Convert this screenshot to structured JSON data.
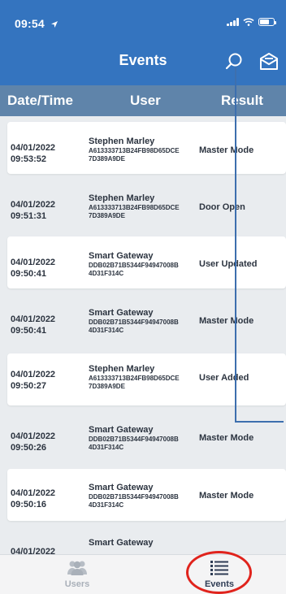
{
  "status_bar": {
    "time": "09:54"
  },
  "header": {
    "title": "Events",
    "search_icon": "search-icon",
    "mail_icon": "mail-icon"
  },
  "columns": {
    "datetime": "Date/Time",
    "user": "User",
    "result": "Result"
  },
  "events": [
    {
      "date": "04/01/2022",
      "time": "09:53:52",
      "user_name": "Stephen Marley",
      "user_id_1": "A613333713B24FB98D65DCE",
      "user_id_2": "7D389A9DE",
      "result": "Master Mode"
    },
    {
      "date": "04/01/2022",
      "time": "09:51:31",
      "user_name": "Stephen Marley",
      "user_id_1": "A613333713B24FB98D65DCE",
      "user_id_2": "7D389A9DE",
      "result": "Door Open"
    },
    {
      "date": "04/01/2022",
      "time": "09:50:41",
      "user_name": "Smart Gateway",
      "user_id_1": "DDB02B71B5344F94947008B",
      "user_id_2": "4D31F314C",
      "result": "User Updated"
    },
    {
      "date": "04/01/2022",
      "time": "09:50:41",
      "user_name": "Smart Gateway",
      "user_id_1": "DDB02B71B5344F94947008B",
      "user_id_2": "4D31F314C",
      "result": "Master Mode"
    },
    {
      "date": "04/01/2022",
      "time": "09:50:27",
      "user_name": "Stephen Marley",
      "user_id_1": "A613333713B24FB98D65DCE",
      "user_id_2": "7D389A9DE",
      "result": "User Added"
    },
    {
      "date": "04/01/2022",
      "time": "09:50:26",
      "user_name": "Smart Gateway",
      "user_id_1": "DDB02B71B5344F94947008B",
      "user_id_2": "4D31F314C",
      "result": "Master Mode"
    },
    {
      "date": "04/01/2022",
      "time": "09:50:16",
      "user_name": "Smart Gateway",
      "user_id_1": "DDB02B71B5344F94947008B",
      "user_id_2": "4D31F314C",
      "result": "Master Mode"
    },
    {
      "date": "04/01/2022",
      "time": "",
      "user_name": "Smart Gateway",
      "user_id_1": "",
      "user_id_2": "",
      "result": ""
    }
  ],
  "tabs": [
    {
      "label": "Users",
      "icon": "users-icon",
      "active": false
    },
    {
      "label": "Events",
      "icon": "list-icon",
      "active": true
    }
  ],
  "colors": {
    "header": "#3474bf",
    "column_header": "#5f84aa",
    "annotation": "#e0231c",
    "tab_active": "#2f3d55",
    "tab_inactive": "#a9b0b9"
  }
}
